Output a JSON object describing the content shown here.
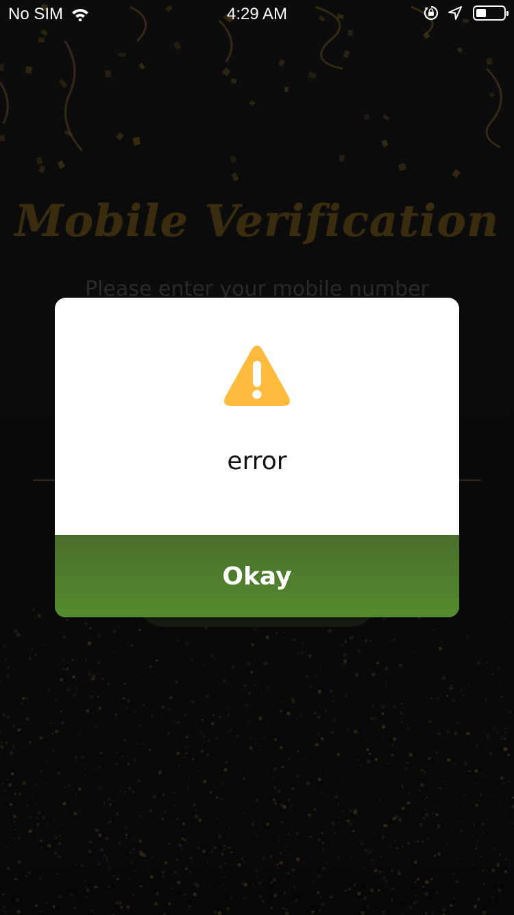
{
  "status_bar": {
    "carrier": "No SIM",
    "time": "4:29 AM",
    "icons": [
      "wifi-icon",
      "orientation-lock-icon",
      "location-icon",
      "battery-icon"
    ]
  },
  "background": {
    "title": "Mobile Verification",
    "subtitle": "Please enter your mobile number",
    "colors": {
      "gold": "#5a4417",
      "confetti": "#6b5220"
    }
  },
  "dialog": {
    "icon": "warning-icon",
    "message": "error",
    "button_label": "Okay",
    "colors": {
      "warning": "#FFBB3C",
      "button": "#4F7E2D"
    }
  }
}
